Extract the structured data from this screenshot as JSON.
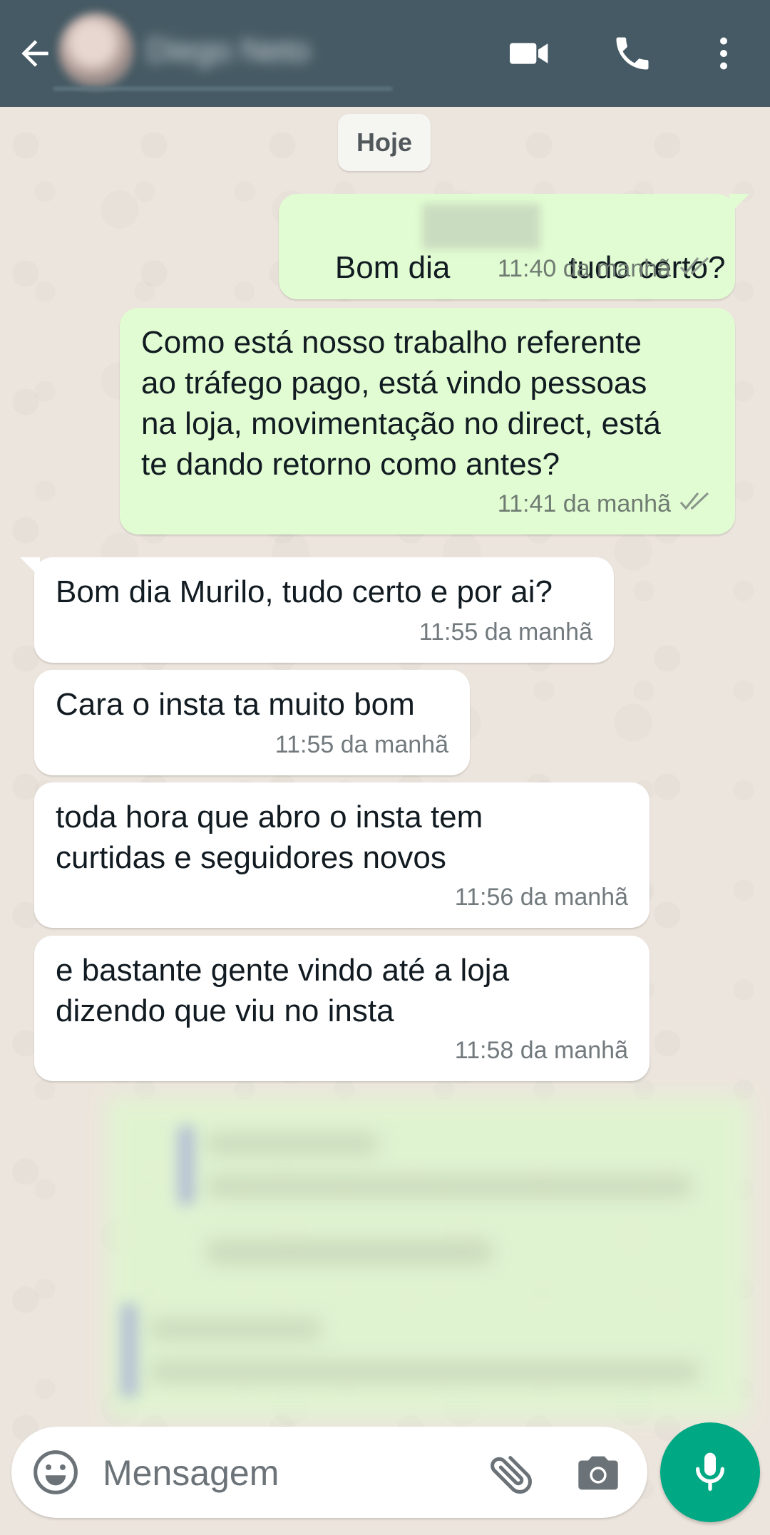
{
  "header": {
    "contact_name": "Diego Neto",
    "back_icon": "arrow-left-icon",
    "video_icon": "video-camera-icon",
    "call_icon": "phone-icon",
    "menu_icon": "more-vert-icon",
    "background_color": "#455a64"
  },
  "date_chip": "Hoje",
  "messages": [
    {
      "direction": "out",
      "text_before": "Bom dia",
      "text_after": "tudo certo?",
      "time": "11:40 da manhã",
      "status": "read"
    },
    {
      "direction": "out",
      "text": "Como está nosso trabalho referente\nao tráfego pago, está vindo pessoas\nna loja, movimentação no direct, está\nte dando retorno como antes?",
      "time": "11:41 da manhã",
      "status": "read"
    },
    {
      "direction": "in",
      "text": "Bom dia Murilo, tudo certo e por ai?",
      "time": "11:55 da manhã"
    },
    {
      "direction": "in",
      "text": "Cara o insta ta muito bom",
      "time": "11:55 da manhã"
    },
    {
      "direction": "in",
      "text": "toda hora que abro o insta tem\ncurtidas e seguidores novos",
      "time": "11:56 da manhã"
    },
    {
      "direction": "in",
      "text": "e bastante gente vindo até a loja\ndizendo que viu no insta",
      "time": "11:58 da manhã"
    }
  ],
  "composer": {
    "placeholder": "Mensagem",
    "emoji_icon": "emoji-icon",
    "attach_icon": "paperclip-icon",
    "camera_icon": "camera-icon",
    "mic_icon": "microphone-icon",
    "accent_color": "#00a884"
  },
  "colors": {
    "outgoing_bubble": "#e1fcd2",
    "incoming_bubble": "#ffffff",
    "wallpaper": "#ece5dd"
  }
}
